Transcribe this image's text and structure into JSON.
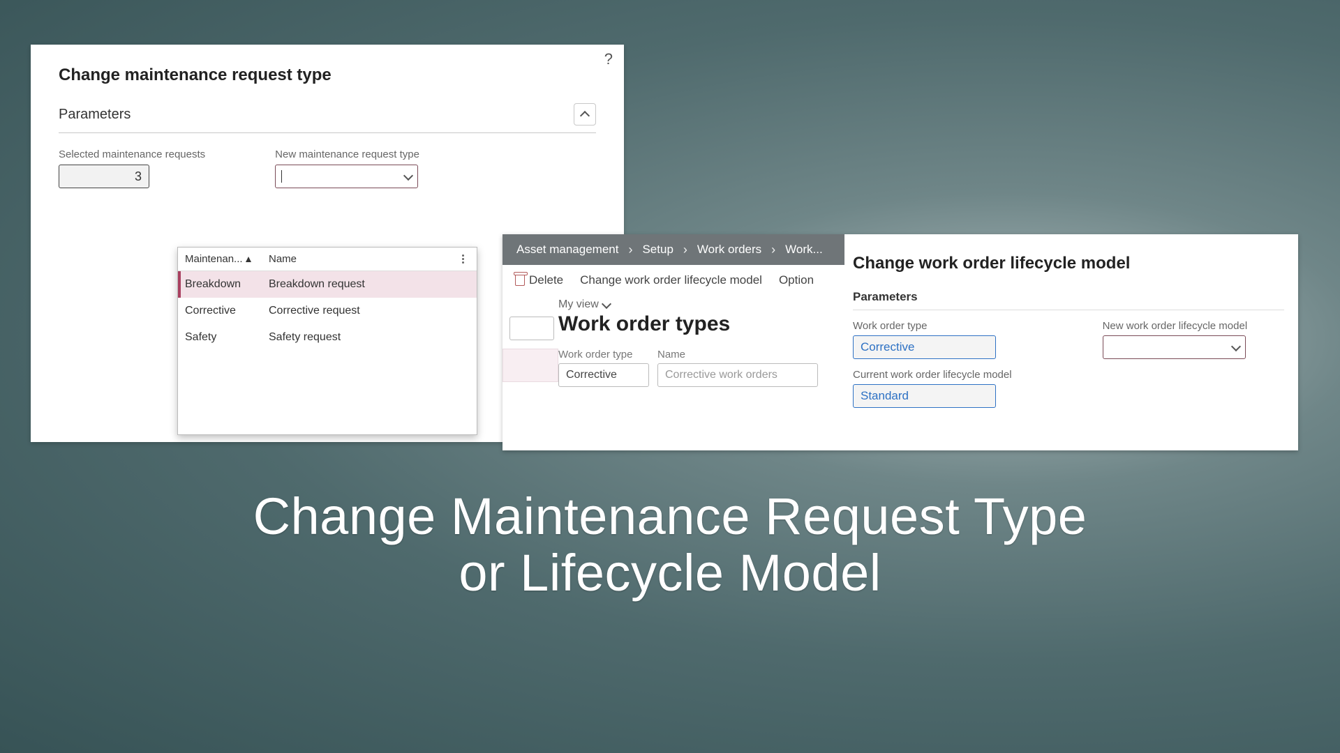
{
  "left_panel": {
    "help_icon": "?",
    "title": "Change maintenance request type",
    "section": "Parameters",
    "selected_label": "Selected maintenance requests",
    "selected_value": "3",
    "new_type_label": "New maintenance request type",
    "dropdown": {
      "col1": "Maintenan...",
      "col2": "Name",
      "rows": [
        {
          "type": "Breakdown",
          "name": "Breakdown request",
          "selected": true
        },
        {
          "type": "Corrective",
          "name": "Corrective request",
          "selected": false
        },
        {
          "type": "Safety",
          "name": "Safety request",
          "selected": false
        }
      ]
    }
  },
  "right_panel": {
    "breadcrumbs": [
      "Asset management",
      "Setup",
      "Work orders",
      "Work..."
    ],
    "toolbar": {
      "delete": "Delete",
      "change_model": "Change work order lifecycle model",
      "options": "Option"
    },
    "view_label": "My view",
    "page_title": "Work order types",
    "fields": {
      "type_lbl": "Work order type",
      "type_val": "Corrective",
      "name_lbl": "Name",
      "name_val": "Corrective work orders"
    }
  },
  "life_panel": {
    "title": "Change work order lifecycle model",
    "section": "Parameters",
    "type_lbl": "Work order type",
    "type_val": "Corrective",
    "current_lbl": "Current work order lifecycle model",
    "current_val": "Standard",
    "new_lbl": "New work order lifecycle model"
  },
  "caption_line1": "Change Maintenance Request Type",
  "caption_line2": "or Lifecycle Model"
}
